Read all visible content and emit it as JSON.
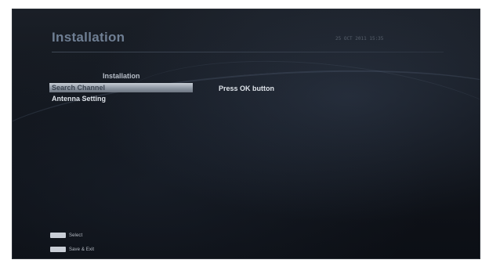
{
  "screen": {
    "title": "Installation",
    "datetime": "25 OCT 2011 15:35"
  },
  "menu": {
    "header": "Installation",
    "items": [
      {
        "label": "Search Channel",
        "selected": true
      },
      {
        "label": "Antenna Setting",
        "selected": false
      }
    ]
  },
  "detail": {
    "hint": "Press OK button"
  },
  "footer": {
    "legend": [
      {
        "key_icon": "ok-key-icon",
        "label": "Select"
      },
      {
        "key_icon": "exit-key-icon",
        "label": "Save & Exit"
      }
    ]
  },
  "colors": {
    "background": "#11151c",
    "title": "#6f7f94",
    "highlight": "#aeb5bf"
  }
}
